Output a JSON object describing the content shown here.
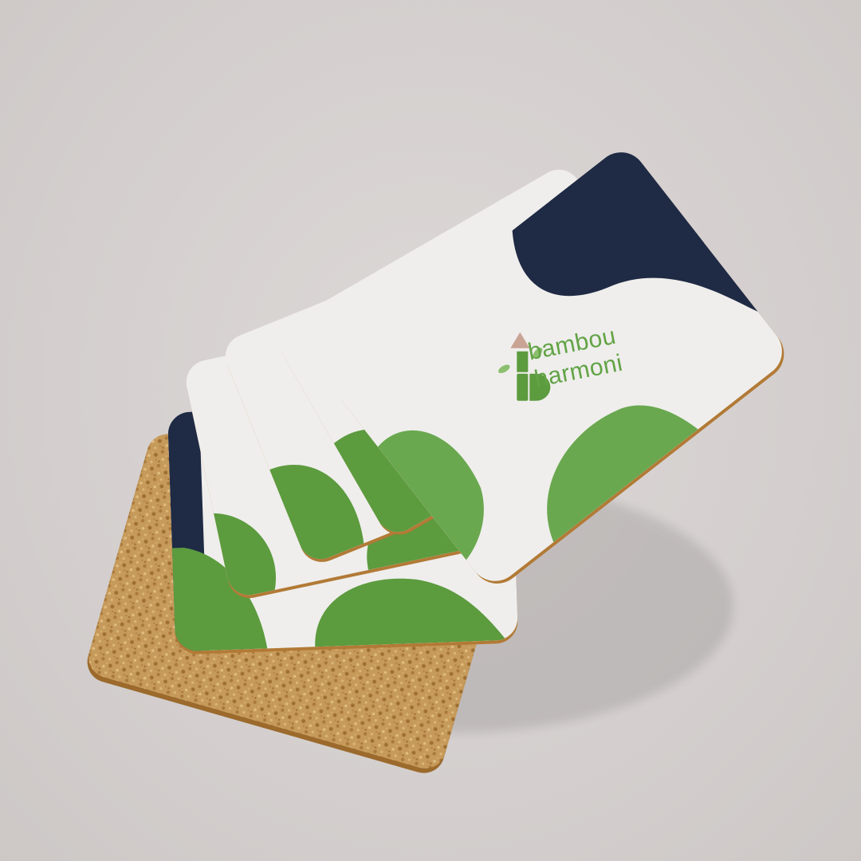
{
  "brand": {
    "line1": "bambou",
    "line2": "harmoni",
    "logo_icon": "bamboo-b-icon"
  },
  "colors": {
    "background": "#d6d1d0",
    "coaster_face": "#efeeec",
    "leaf_green": "#5c9b3e",
    "navy": "#1f2a44",
    "cork": "#c49a5c",
    "edge": "#b07a38"
  },
  "objects": {
    "coaster_count": 5,
    "cork_base": "cork-coaster"
  }
}
